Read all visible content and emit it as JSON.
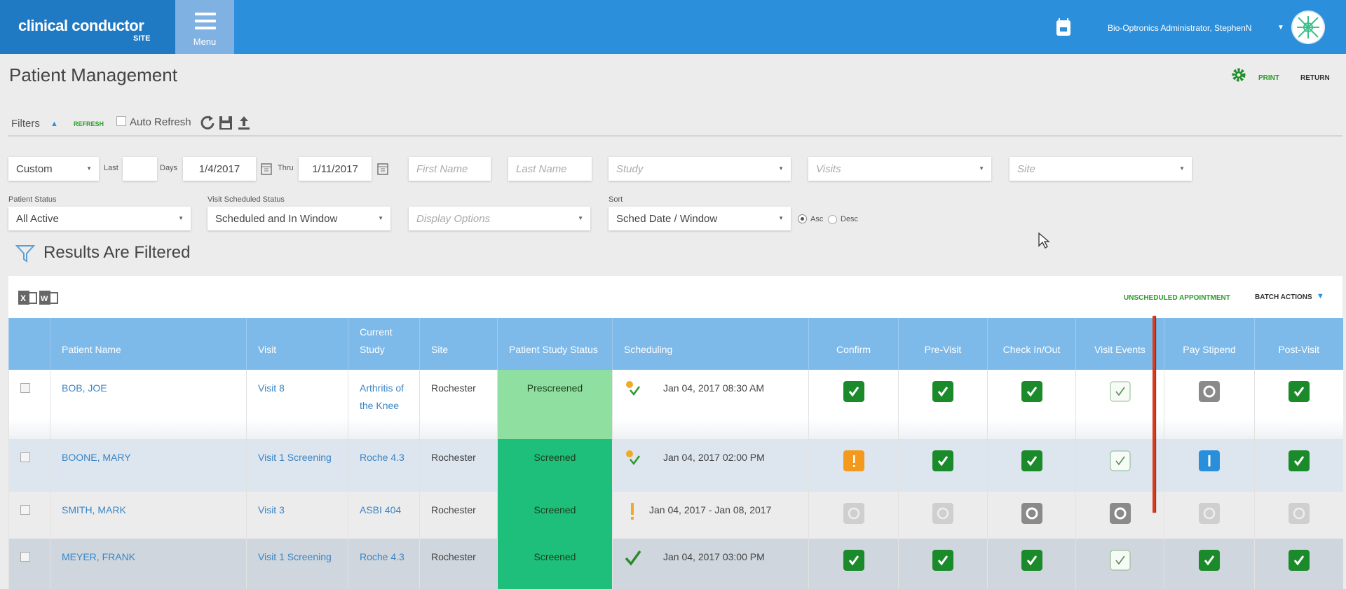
{
  "header": {
    "logo_main": "clinical conductor",
    "logo_sub": "SITE",
    "menu_label": "Menu",
    "user_name": "Bio-Optronics Administrator, StephenN"
  },
  "page": {
    "title": "Patient Management",
    "print": "PRINT",
    "return": "RETURN"
  },
  "toolbar": {
    "filters": "Filters",
    "refresh": "REFRESH",
    "auto_refresh": "Auto Refresh"
  },
  "filters": {
    "range_type": "Custom",
    "last_label": "Last",
    "last_value": "",
    "days_label": "Days",
    "from_date": "1/4/2017",
    "thru_label": "Thru",
    "to_date": "1/11/2017",
    "first_name_ph": "First Name",
    "last_name_ph": "Last Name",
    "study_ph": "Study",
    "visits_ph": "Visits",
    "site_ph": "Site",
    "patient_status_label": "Patient Status",
    "patient_status": "All Active",
    "visit_sched_label": "Visit Scheduled Status",
    "visit_sched": "Scheduled and In Window",
    "display_options_ph": "Display Options",
    "sort_label": "Sort",
    "sort": "Sched Date / Window",
    "asc": "Asc",
    "desc": "Desc",
    "sort_dir": "Asc"
  },
  "results": {
    "title": "Results Are Filtered",
    "unscheduled": "UNSCHEDULED APPOINTMENT",
    "batch_actions": "BATCH ACTIONS"
  },
  "table": {
    "columns": [
      "",
      "Patient Name",
      "Visit",
      "Current Study",
      "Site",
      "Patient Study Status",
      "Scheduling",
      "Confirm",
      "Pre-Visit",
      "Check In/Out",
      "Visit Events",
      "Pay Stipend",
      "Post-Visit"
    ],
    "rows": [
      {
        "name": "BOB, JOE",
        "visit": "Visit 8",
        "study": "Arthritis of the Knee",
        "site": "Rochester",
        "status": "Prescreened",
        "sched_icon": "dot-check",
        "sched": "Jan 04, 2017 08:30 AM",
        "steps": [
          "check",
          "check",
          "check",
          "check-light",
          "circle-dark",
          "check"
        ]
      },
      {
        "name": "BOONE, MARY",
        "visit": "Visit 1 Screening",
        "study": "Roche 4.3",
        "site": "Rochester",
        "status": "Screened",
        "sched_icon": "dot-check",
        "sched": "Jan 04, 2017 02:00 PM",
        "steps": [
          "warn",
          "check",
          "check",
          "check-light",
          "info",
          "check"
        ]
      },
      {
        "name": "SMITH, MARK",
        "visit": "Visit 3",
        "study": "ASBI 404",
        "site": "Rochester",
        "status": "Screened",
        "sched_icon": "exclaim",
        "sched": "Jan 04, 2017 - Jan 08, 2017",
        "steps": [
          "circle-light",
          "circle-light",
          "circle-dark",
          "circle-dark",
          "circle-light",
          "circle-light"
        ]
      },
      {
        "name": "MEYER, FRANK",
        "visit": "Visit 1 Screening",
        "study": "Roche 4.3",
        "site": "Rochester",
        "status": "Screened",
        "sched_icon": "check",
        "sched": "Jan 04, 2017 03:00 PM",
        "steps": [
          "check",
          "check",
          "check",
          "check-light",
          "check",
          "check"
        ]
      }
    ]
  },
  "colors": {
    "topbar": "#2c8fdb",
    "table_header": "#7db9e9",
    "prescreened": "#8fe0a0",
    "screened": "#1dbf7a",
    "check": "#1a8a2a",
    "warn": "#f39a1e",
    "info": "#2a8fdb"
  }
}
